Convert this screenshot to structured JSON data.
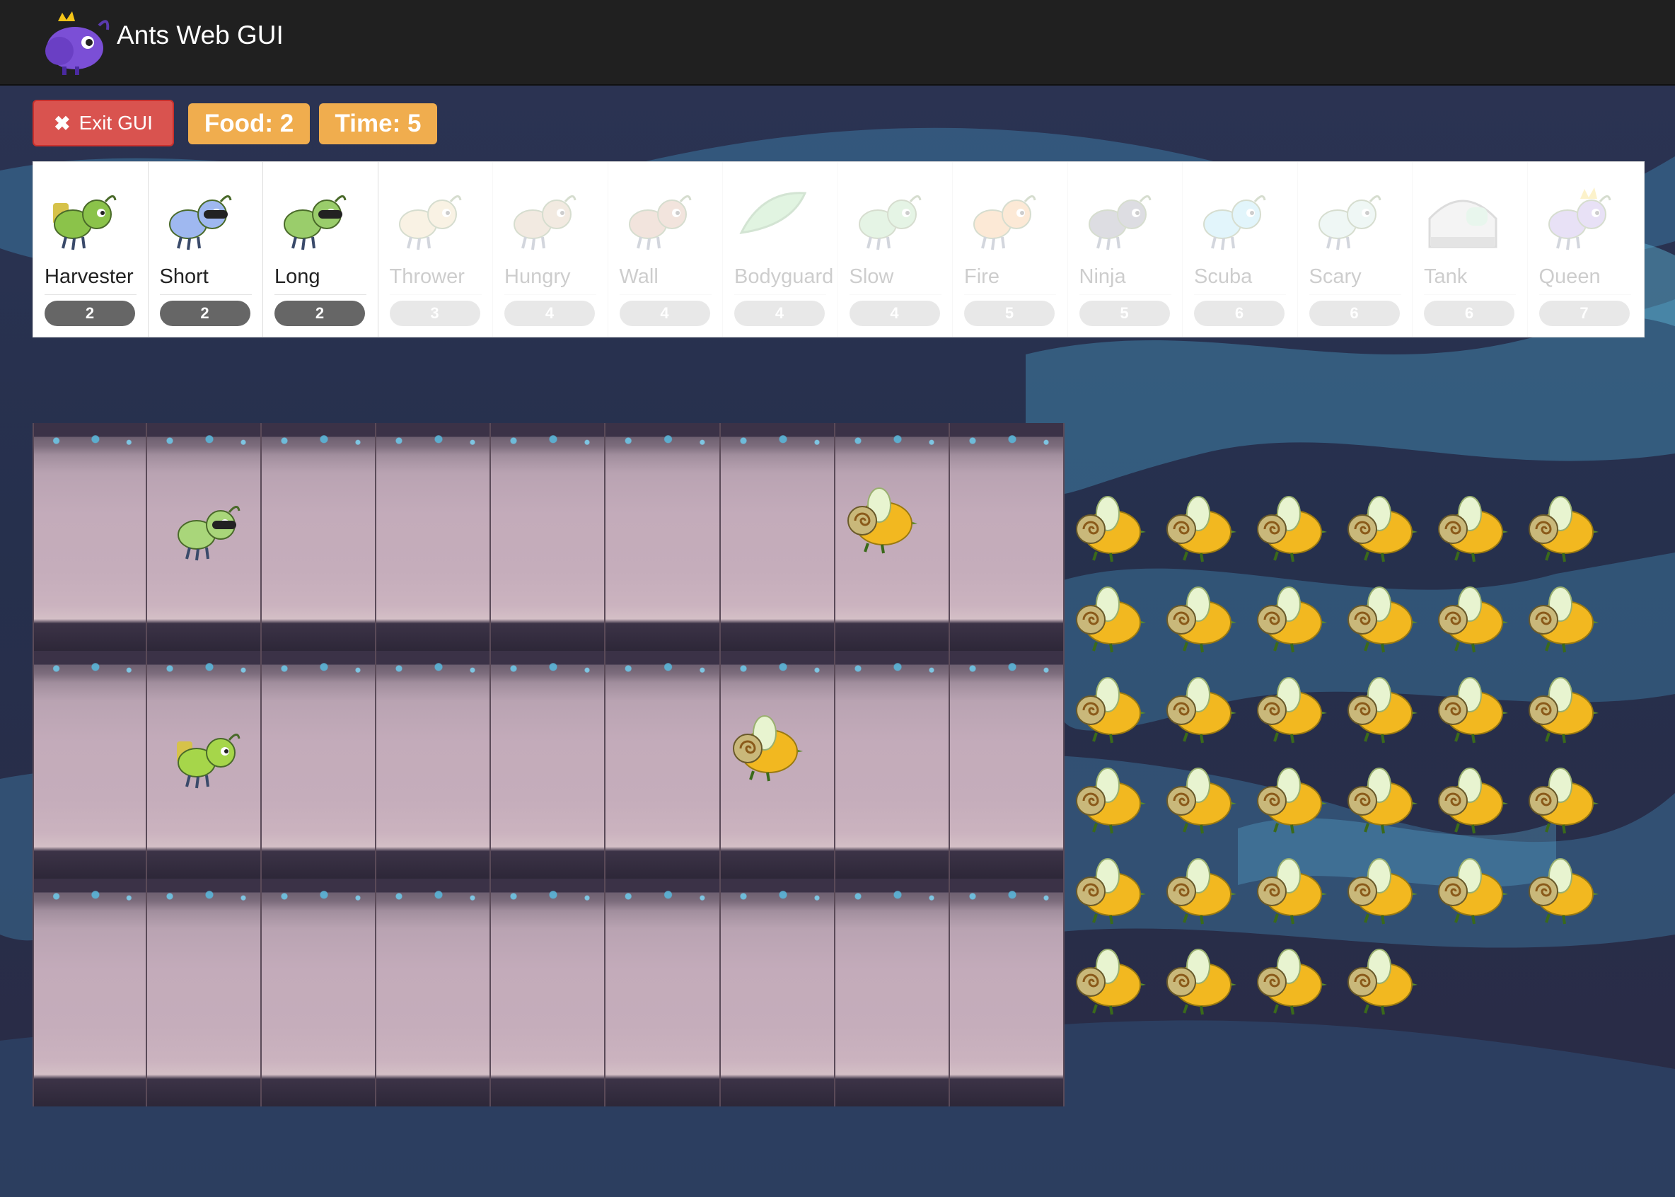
{
  "navbar": {
    "title": "Ants Web GUI",
    "logo_icon": "queen-ant-logo-icon"
  },
  "controls": {
    "exit_label": "Exit GUI",
    "food_label": "Food: 2",
    "time_label": "Time: 5"
  },
  "ant_types": [
    {
      "name": "Harvester",
      "cost": "2",
      "enabled": true,
      "icon": "harvester-ant-icon",
      "color": "#8bc34a"
    },
    {
      "name": "Short",
      "cost": "2",
      "enabled": true,
      "icon": "short-thrower-ant-icon",
      "color": "#9fb8f0"
    },
    {
      "name": "Long",
      "cost": "2",
      "enabled": true,
      "icon": "long-thrower-ant-icon",
      "color": "#9acd6b"
    },
    {
      "name": "Thrower",
      "cost": "3",
      "enabled": false,
      "icon": "thrower-ant-icon",
      "color": "#e6c98a"
    },
    {
      "name": "Hungry",
      "cost": "4",
      "enabled": false,
      "icon": "hungry-ant-icon",
      "color": "#c9a27a"
    },
    {
      "name": "Wall",
      "cost": "4",
      "enabled": false,
      "icon": "wall-ant-icon",
      "color": "#c78a6a"
    },
    {
      "name": "Bodyguard",
      "cost": "4",
      "enabled": false,
      "icon": "bodyguard-leaf-icon",
      "color": "#7bd07b"
    },
    {
      "name": "Slow",
      "cost": "4",
      "enabled": false,
      "icon": "slow-ant-icon",
      "color": "#8bd08b"
    },
    {
      "name": "Fire",
      "cost": "5",
      "enabled": false,
      "icon": "fire-ant-icon",
      "color": "#f5a04a"
    },
    {
      "name": "Ninja",
      "cost": "5",
      "enabled": false,
      "icon": "ninja-ant-icon",
      "color": "#6a6a80"
    },
    {
      "name": "Scuba",
      "cost": "6",
      "enabled": false,
      "icon": "scuba-ant-icon",
      "color": "#7fd4f0"
    },
    {
      "name": "Scary",
      "cost": "6",
      "enabled": false,
      "icon": "scary-ant-icon",
      "color": "#b9dcd6"
    },
    {
      "name": "Tank",
      "cost": "6",
      "enabled": false,
      "icon": "tank-ant-icon",
      "color": "#9a9a9a"
    },
    {
      "name": "Queen",
      "cost": "7",
      "enabled": false,
      "icon": "queen-ant-icon",
      "color": "#9a7ad8"
    }
  ],
  "board": {
    "tunnels": 3,
    "places_per_tunnel": 9,
    "occupants": [
      {
        "tunnel": 0,
        "place": 1,
        "kind": "ant",
        "icon": "long-thrower-ant-icon"
      },
      {
        "tunnel": 0,
        "place": 7,
        "kind": "bee",
        "icon": "bee-icon"
      },
      {
        "tunnel": 1,
        "place": 1,
        "kind": "ant",
        "icon": "harvester-ant-icon"
      },
      {
        "tunnel": 1,
        "place": 6,
        "kind": "bee",
        "icon": "bee-icon"
      }
    ]
  },
  "hive": {
    "bee_count": 34,
    "columns": 6,
    "icon": "bee-icon"
  },
  "colors": {
    "navbar": "#202020",
    "exit_button": "#d9534f",
    "status_badge": "#f0ad4e",
    "cost_badge": "#666666"
  }
}
